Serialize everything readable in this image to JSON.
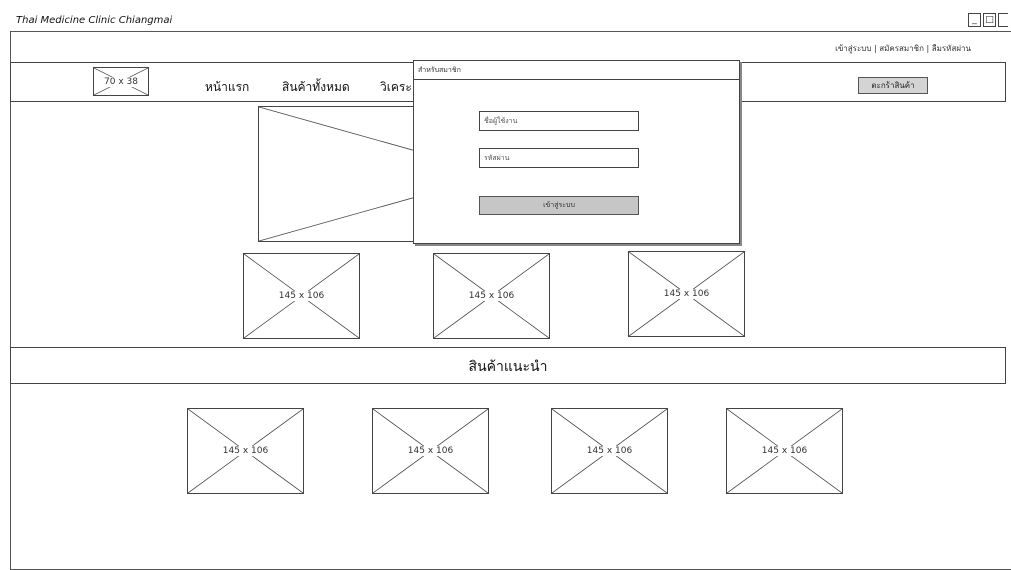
{
  "window": {
    "title": "Thai Medicine Clinic Chiangmai"
  },
  "top_links": {
    "text": "เข้าสู่ระบบ | สมัครสมาชิก | ลืมรหัสผ่าน"
  },
  "nav": {
    "logo_placeholder": "70 x 38",
    "items": [
      "หน้าแรก",
      "สินค้าทั้งหมด",
      "วิเคระ"
    ],
    "cart_label": "ตะกร้าสินค้า"
  },
  "featured": {
    "placeholders": [
      "145 x 106",
      "145 x 106",
      "145 x 106"
    ]
  },
  "recommended": {
    "title": "สินค้าแนะนำ",
    "placeholders": [
      "145 x 106",
      "145 x 106",
      "145 x 106",
      "145 x 106"
    ]
  },
  "login_dialog": {
    "title": "สำหรับสมาชิก",
    "username_placeholder": "ชื่อผู้ใช้งาน",
    "password_placeholder": "รหัสผ่าน",
    "submit_label": "เข้าสู่ระบบ"
  }
}
